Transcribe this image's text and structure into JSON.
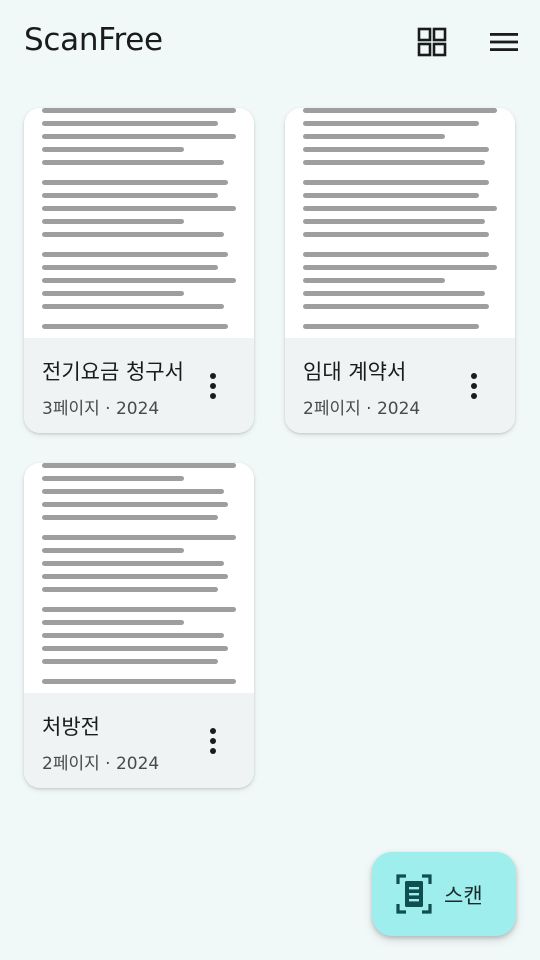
{
  "app": {
    "title": "ScanFree"
  },
  "toolbar": {
    "view_toggle_icon": "grid-view-icon",
    "menu_icon": "hamburger-menu-icon"
  },
  "documents": [
    {
      "title": "전기요금 청구서",
      "meta": "3페이지 · 2024"
    },
    {
      "title": "임대 계약서",
      "meta": "2페이지 · 2024"
    },
    {
      "title": "처방전",
      "meta": "2페이지 · 2024"
    }
  ],
  "fab": {
    "label": "스캔",
    "icon": "document-scanner-icon"
  },
  "colors": {
    "background": "#f1f8f8",
    "card_footer": "#eff3f3",
    "fab": "#9eeeee",
    "icon": "#1b1b1b",
    "fab_icon": "#0f4f4f",
    "thumb_line": "#9e9e9e"
  }
}
